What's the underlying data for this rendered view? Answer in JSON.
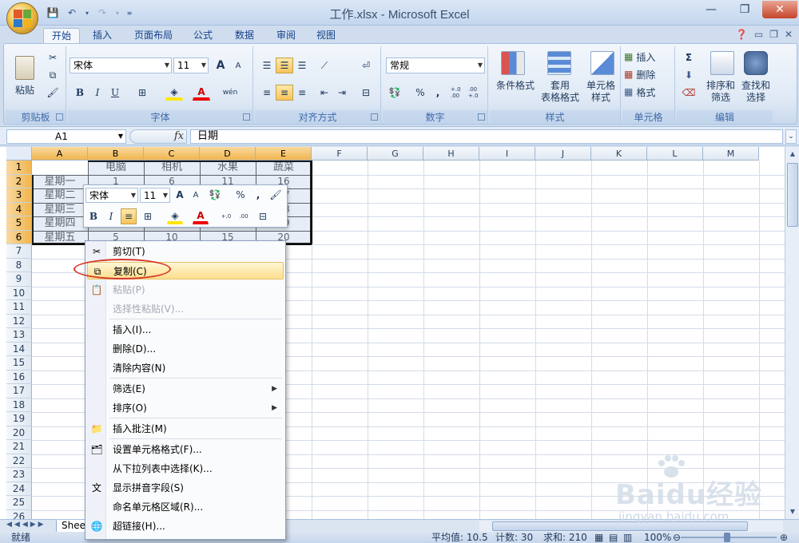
{
  "window": {
    "title": "工作.xlsx - Microsoft Excel"
  },
  "tabs": [
    {
      "label": "开始",
      "active": true
    },
    {
      "label": "插入"
    },
    {
      "label": "页面布局"
    },
    {
      "label": "公式"
    },
    {
      "label": "数据"
    },
    {
      "label": "审阅"
    },
    {
      "label": "视图"
    }
  ],
  "ribbon": {
    "clipboard": {
      "label": "剪贴板",
      "paste": "粘贴"
    },
    "font": {
      "label": "字体",
      "name": "宋体",
      "size": "11",
      "bold": "B",
      "italic": "I",
      "underline": "U",
      "grow": "A",
      "shrink": "A",
      "phonetic": "wén"
    },
    "alignment": {
      "label": "对齐方式"
    },
    "number": {
      "label": "数字",
      "format": "常规",
      "percent": "%",
      "comma": ",",
      "inc_decimal": "+.0 .00",
      "dec_decimal": ".00 +.0"
    },
    "styles": {
      "label": "样式",
      "conditional": "条件格式",
      "table": "套用\n表格格式",
      "cell": "单元格\n样式"
    },
    "cells": {
      "label": "单元格",
      "insert": "插入",
      "delete": "删除",
      "format": "格式"
    },
    "editing": {
      "label": "编辑",
      "sigma": "Σ",
      "sort": "排序和\n筛选",
      "find": "查找和\n选择"
    }
  },
  "formula_bar": {
    "name_box": "A1",
    "fx": "fx",
    "value": "日期"
  },
  "columns": [
    "A",
    "B",
    "C",
    "D",
    "E",
    "F",
    "G",
    "H",
    "I",
    "J",
    "K",
    "L",
    "M"
  ],
  "rows": [
    "1",
    "2",
    "3",
    "4",
    "5",
    "6",
    "7",
    "8",
    "9",
    "10",
    "11",
    "12",
    "13",
    "14",
    "15",
    "16",
    "17",
    "18",
    "19",
    "20",
    "21",
    "22",
    "23",
    "24",
    "25",
    "26"
  ],
  "table": [
    [
      "日期",
      "电脑",
      "相机",
      "水果",
      "蔬菜"
    ],
    [
      "星期一",
      "1",
      "6",
      "11",
      "16"
    ],
    [
      "星期二",
      "",
      "",
      "",
      "17"
    ],
    [
      "星期三",
      "",
      "",
      "",
      "18"
    ],
    [
      "星期四",
      "",
      "",
      "",
      "19"
    ],
    [
      "星期五",
      "5",
      "10",
      "15",
      "20"
    ]
  ],
  "mini_toolbar": {
    "font": "宋体",
    "size": "11",
    "bold": "B",
    "italic": "I",
    "percent": "%",
    "comma": ","
  },
  "context_menu": [
    {
      "label": "剪切(T)",
      "icon": "scissors-icon"
    },
    {
      "label": "复制(C)",
      "icon": "copy-icon",
      "highlighted": true
    },
    {
      "label": "粘贴(P)",
      "icon": "paste-icon",
      "disabled": true
    },
    {
      "label": "选择性粘贴(V)...",
      "disabled": true,
      "separator_after": true
    },
    {
      "label": "插入(I)..."
    },
    {
      "label": "删除(D)..."
    },
    {
      "label": "清除内容(N)",
      "separator_after": true
    },
    {
      "label": "筛选(E)",
      "submenu": true
    },
    {
      "label": "排序(O)",
      "submenu": true,
      "separator_after": true
    },
    {
      "label": "插入批注(M)",
      "icon": "comment-icon",
      "separator_after": true
    },
    {
      "label": "设置单元格格式(F)...",
      "icon": "format-cells-icon"
    },
    {
      "label": "从下拉列表中选择(K)..."
    },
    {
      "label": "显示拼音字段(S)",
      "icon": "phonetic-icon"
    },
    {
      "label": "命名单元格区域(R)..."
    },
    {
      "label": "超链接(H)...",
      "icon": "hyperlink-icon"
    }
  ],
  "sheet_tab": "Shee",
  "status": {
    "ready": "就绪",
    "average": "平均值: 10.5",
    "count": "计数: 30",
    "sum": "求和: 210",
    "zoom": "100%"
  },
  "watermark": {
    "text": "Baidu经验",
    "url": "jingyan.baidu.com"
  }
}
